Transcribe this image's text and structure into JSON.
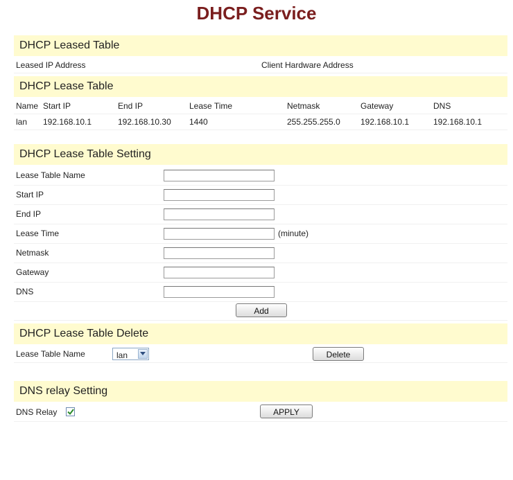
{
  "page_title": "DHCP Service",
  "leased_table": {
    "heading": "DHCP Leased Table",
    "col_ip": "Leased IP Address",
    "col_hw": "Client Hardware Address"
  },
  "lease_table": {
    "heading": "DHCP Lease Table",
    "headers": [
      "Name",
      "Start IP",
      "End IP",
      "Lease Time",
      "Netmask",
      "Gateway",
      "DNS"
    ],
    "rows": [
      [
        "lan",
        "192.168.10.1",
        "192.168.10.30",
        "1440",
        "255.255.255.0",
        "192.168.10.1",
        "192.168.10.1"
      ]
    ]
  },
  "setting": {
    "heading": "DHCP Lease Table Setting",
    "fields": [
      {
        "label": "Lease Table Name",
        "value": ""
      },
      {
        "label": "Start IP",
        "value": ""
      },
      {
        "label": "End IP",
        "value": ""
      },
      {
        "label": "Lease Time",
        "value": "",
        "unit": "(minute)"
      },
      {
        "label": "Netmask",
        "value": ""
      },
      {
        "label": "Gateway",
        "value": ""
      },
      {
        "label": "DNS",
        "value": ""
      }
    ],
    "add_label": "Add"
  },
  "delete": {
    "heading": "DHCP Lease Table Delete",
    "label": "Lease Table Name",
    "selected": "lan",
    "delete_label": "Delete"
  },
  "dns_relay": {
    "heading": "DNS relay Setting",
    "label": "DNS Relay",
    "checked": true,
    "apply_label": "APPLY"
  },
  "colors": {
    "title": "#7a1e1e",
    "section_bg": "#fffbcf",
    "check": "#2a8a2a"
  }
}
